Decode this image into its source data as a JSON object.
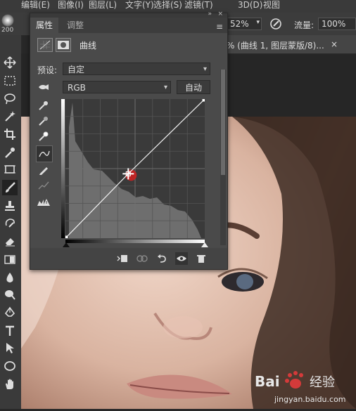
{
  "menubar": {
    "items": [
      "编辑(E)",
      "图像(I)",
      "图层(L)",
      "文字(Y)",
      "选择(S)",
      "滤镜(T)",
      "3D(D)",
      "视图"
    ]
  },
  "options": {
    "brush_size": "200",
    "zoom": "52%",
    "flow_label": "流量:",
    "flow_value": "100%"
  },
  "document_tab": {
    "title": "% (曲线 1, 图层蒙版/8)...",
    "close": "×"
  },
  "properties_panel": {
    "tabs": [
      {
        "label": "属性",
        "active": true
      },
      {
        "label": "调整",
        "active": false
      }
    ],
    "title": "曲线",
    "preset_label": "预设:",
    "preset_value": "自定",
    "channel_value": "RGB",
    "auto_button": "自动",
    "curve": {
      "input_range": [
        0,
        255
      ],
      "output_range": [
        0,
        255
      ],
      "points": [
        [
          0,
          0
        ],
        [
          115,
          118
        ],
        [
          255,
          255
        ]
      ],
      "grid": "on"
    }
  },
  "toolbar": {
    "icons": [
      "move-icon",
      "marquee-icon",
      "lasso-icon",
      "magic-wand-icon",
      "crop-icon",
      "eyedropper-icon",
      "frame-icon",
      "brush-icon",
      "clone-stamp-icon",
      "history-brush-icon",
      "eraser-icon",
      "gradient-icon",
      "blur-icon",
      "dodge-icon",
      "pen-icon",
      "type-icon",
      "path-select-icon",
      "shape-icon",
      "hand-icon"
    ]
  },
  "watermark": {
    "text": "Bai 经验",
    "sub": "jingyan.baidu.com"
  }
}
